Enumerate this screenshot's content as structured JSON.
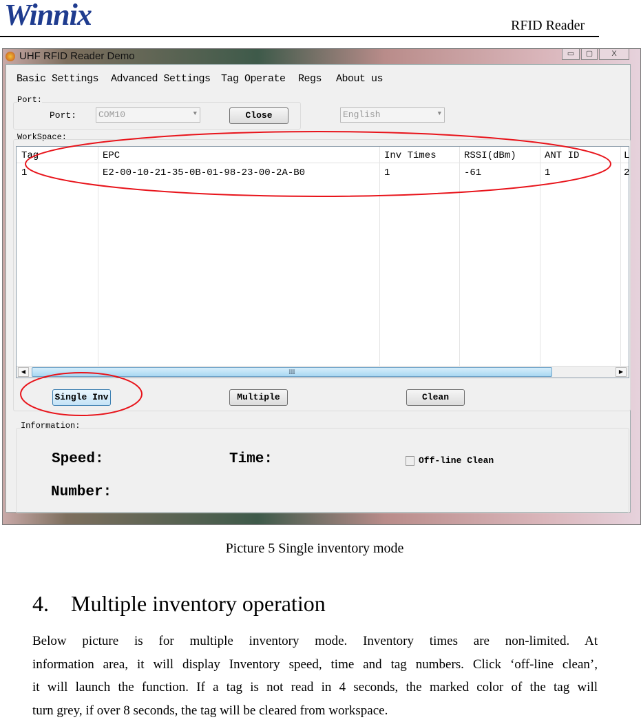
{
  "header": {
    "logo": "Winnix",
    "doc_title": "RFID Reader"
  },
  "window": {
    "title": "UHF RFID Reader Demo",
    "controls": {
      "minimize": "▭",
      "maximize": "▢",
      "close": "X"
    },
    "menu": [
      "Basic Settings",
      "Advanced Settings",
      "Tag Operate",
      "Regs",
      "About us"
    ],
    "port_group": {
      "label": "Port:",
      "port_label": "Port:",
      "port_value": "COM10",
      "close_button": "Close",
      "language_value": "English"
    },
    "workspace": {
      "label": "WorkSpace:",
      "columns": [
        "Tag",
        "EPC",
        "Inv Times",
        "RSSI(dBm)",
        "ANT ID",
        "L"
      ],
      "rows": [
        [
          "1",
          "E2-00-10-21-35-0B-01-98-23-00-2A-B0",
          "1",
          "-61",
          "1",
          "2"
        ]
      ],
      "scroll_thumb": "III"
    },
    "buttons": {
      "single": "Single Inv",
      "multiple": "Multiple",
      "clean": "Clean"
    },
    "information": {
      "label": "Information:",
      "speed": "Speed:",
      "time": "Time:",
      "number": "Number:",
      "offline_clean": "Off-line Clean",
      "offline_clean_checked": false
    }
  },
  "annotation_color": "#e8141b",
  "caption": "Picture 5 Single inventory mode",
  "section": {
    "heading": "4.    Multiple inventory operation",
    "paragraph_lines": [
      "Below picture is for multiple inventory mode. Inventory times are non-limited. At",
      "information area, it will display Inventory speed, time and tag numbers. Click ‘off-line clean’,",
      "it will launch the function. If a tag is not read in 4 seconds, the marked color of the tag will",
      "turn grey, if over 8 seconds, the tag will be cleared from workspace."
    ]
  }
}
